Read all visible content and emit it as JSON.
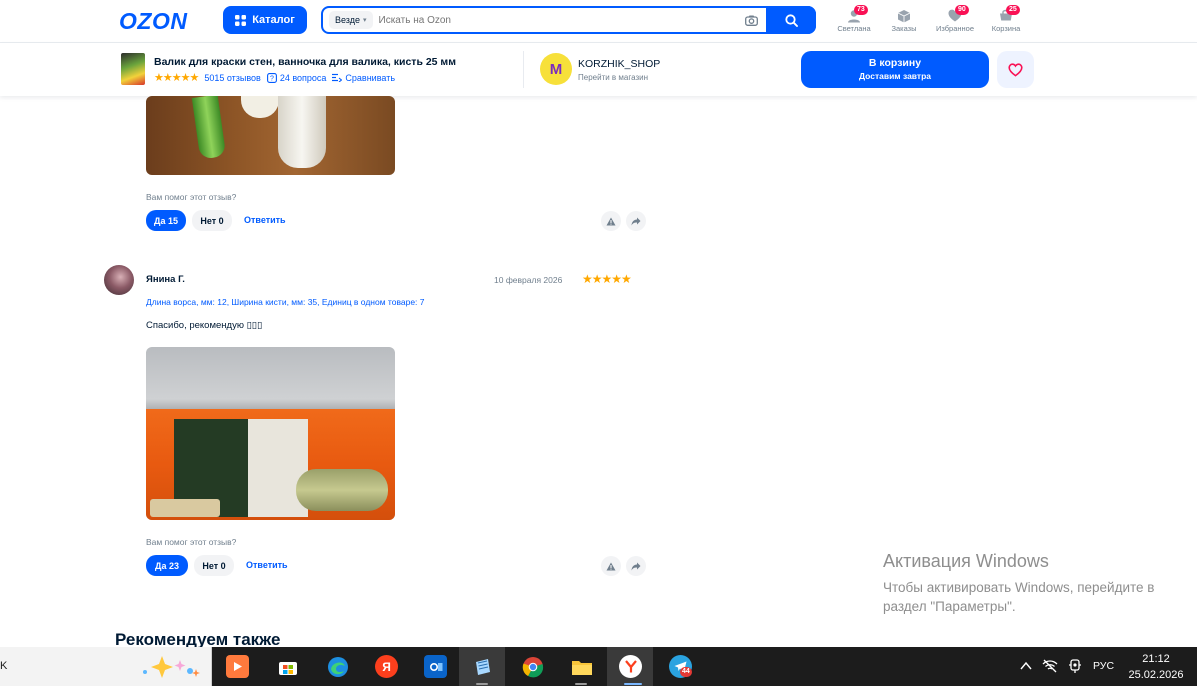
{
  "header": {
    "logo": "OZON",
    "catalog_label": "Каталог",
    "search_scope": "Везде",
    "search_placeholder": "Искать на Ozon",
    "nav": [
      {
        "label": "Светлана",
        "badge": "73"
      },
      {
        "label": "Заказы",
        "badge": ""
      },
      {
        "label": "Избранное",
        "badge": "90"
      },
      {
        "label": "Корзина",
        "badge": "25"
      }
    ]
  },
  "product_bar": {
    "title": "Валик для краски стен, ванночка для валика, кисть 25 мм",
    "stars": "★★★★★",
    "reviews": "5015 отзывов",
    "questions": "24 вопроса",
    "compare": "Сравнивать",
    "shop_name": "KORZHIK_SHOP",
    "shop_link": "Перейти в магазин",
    "cart_label": "В корзину",
    "cart_sub": "Доставим завтра"
  },
  "reviews": [
    {
      "helpful_q": "Вам помог этот отзыв?",
      "yes": "Да 15",
      "no": "Нет 0",
      "reply": "Ответить"
    },
    {
      "author": "Янина Г.",
      "date": "10 февраля 2026",
      "stars": "★★★★★",
      "variant": "Длина ворса, мм: 12, Ширина кисти, мм: 35, Единиц в одном товаре: 7",
      "text": "Спасибо, рекомендую ▯▯▯",
      "helpful_q": "Вам помог этот отзыв?",
      "yes": "Да 23",
      "no": "Нет 0",
      "reply": "Ответить"
    }
  ],
  "recommend_title": "Рекомендуем также",
  "windows_activation": {
    "title": "Активация Windows",
    "line1": "Чтобы активировать Windows, перейдите в",
    "line2": "раздел \"Параметры\"."
  },
  "taskbar": {
    "left_char": "K",
    "yandex_label": "Я",
    "telegram_badge": "44",
    "lang": "РУС",
    "time": "21:12",
    "date": "25.02.2026"
  },
  "colors": {
    "brand": "#005bff",
    "badge": "#f91155",
    "star": "#ffa800"
  }
}
